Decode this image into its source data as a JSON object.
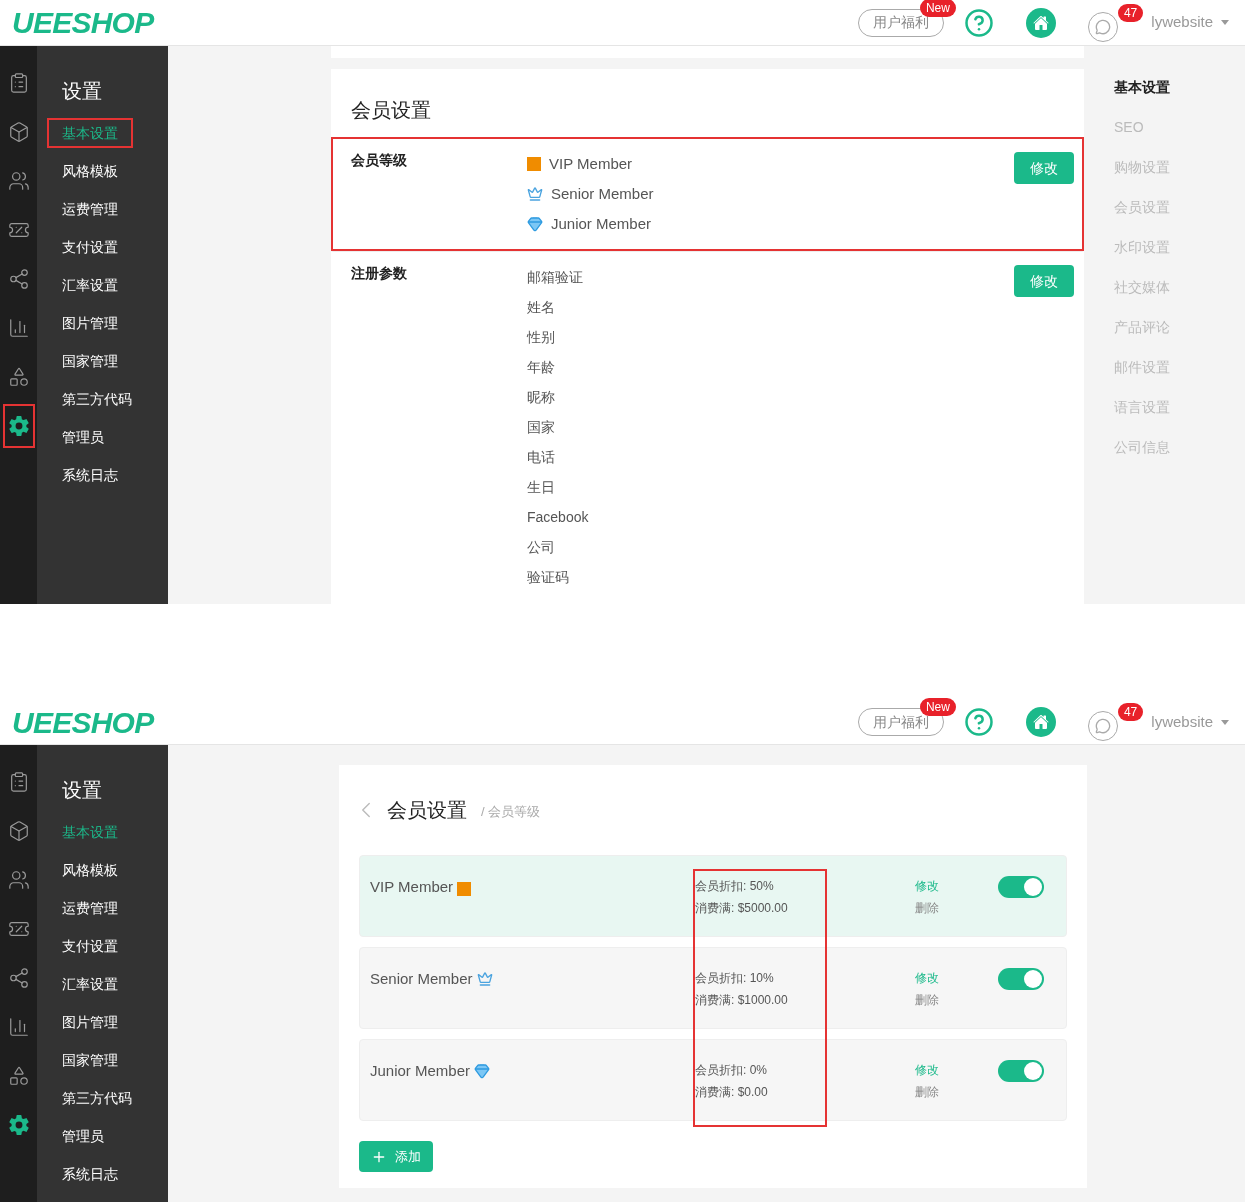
{
  "screens": [
    {
      "kind": "overview",
      "header": {
        "logo": "UEESHOP",
        "benefit": "用户福利",
        "benefit_badge": "New",
        "messages_count": "47",
        "user": "lywebsite"
      },
      "rail": [
        {
          "selected": false,
          "highlighted": false
        },
        {
          "selected": false,
          "highlighted": false
        },
        {
          "selected": false,
          "highlighted": false
        },
        {
          "selected": false,
          "highlighted": false
        },
        {
          "selected": false,
          "highlighted": false
        },
        {
          "selected": false,
          "highlighted": false
        },
        {
          "selected": false,
          "highlighted": false
        },
        {
          "selected": true,
          "highlighted": true
        }
      ],
      "menu": {
        "title": "设置",
        "items": [
          {
            "label": "基本设置",
            "selected": true,
            "highlighted": true
          },
          {
            "label": "风格模板",
            "selected": false,
            "highlighted": false
          },
          {
            "label": "运费管理",
            "selected": false,
            "highlighted": false
          },
          {
            "label": "支付设置",
            "selected": false,
            "highlighted": false
          },
          {
            "label": "汇率设置",
            "selected": false,
            "highlighted": false
          },
          {
            "label": "图片管理",
            "selected": false,
            "highlighted": false
          },
          {
            "label": "国家管理",
            "selected": false,
            "highlighted": false
          },
          {
            "label": "第三方代码",
            "selected": false,
            "highlighted": false
          },
          {
            "label": "管理员",
            "selected": false,
            "highlighted": false
          },
          {
            "label": "系统日志",
            "selected": false,
            "highlighted": false
          }
        ]
      },
      "title": "会员设置",
      "sections": [
        {
          "kind": "levels",
          "label": "会员等级",
          "highlighted": true,
          "button": "修改",
          "values": [
            "VIP Member",
            "Senior Member",
            "Junior Member"
          ]
        },
        {
          "kind": "fields",
          "label": "注册参数",
          "highlighted": false,
          "button": "修改",
          "values": [
            "邮箱验证",
            "姓名",
            "性别",
            "年龄",
            "昵称",
            "国家",
            "电话",
            "生日",
            "Facebook",
            "公司",
            "验证码"
          ]
        }
      ],
      "right_nav": [
        {
          "label": "基本设置",
          "selected": true
        },
        {
          "label": "SEO",
          "selected": false
        },
        {
          "label": "购物设置",
          "selected": false
        },
        {
          "label": "会员设置",
          "selected": false
        },
        {
          "label": "水印设置",
          "selected": false
        },
        {
          "label": "社交媒体",
          "selected": false
        },
        {
          "label": "产品评论",
          "selected": false
        },
        {
          "label": "邮件设置",
          "selected": false
        },
        {
          "label": "语言设置",
          "selected": false
        },
        {
          "label": "公司信息",
          "selected": false
        }
      ]
    },
    {
      "kind": "levels",
      "header": {
        "logo": "UEESHOP",
        "benefit": "用户福利",
        "benefit_badge": "New",
        "messages_count": "47",
        "user": "lywebsite"
      },
      "rail": [
        {
          "selected": false,
          "highlighted": false
        },
        {
          "selected": false,
          "highlighted": false
        },
        {
          "selected": false,
          "highlighted": false
        },
        {
          "selected": false,
          "highlighted": false
        },
        {
          "selected": false,
          "highlighted": false
        },
        {
          "selected": false,
          "highlighted": false
        },
        {
          "selected": false,
          "highlighted": false
        },
        {
          "selected": true,
          "highlighted": false
        }
      ],
      "menu": {
        "title": "设置",
        "items": [
          {
            "label": "基本设置",
            "selected": true,
            "highlighted": false
          },
          {
            "label": "风格模板",
            "selected": false,
            "highlighted": false
          },
          {
            "label": "运费管理",
            "selected": false,
            "highlighted": false
          },
          {
            "label": "支付设置",
            "selected": false,
            "highlighted": false
          },
          {
            "label": "汇率设置",
            "selected": false,
            "highlighted": false
          },
          {
            "label": "图片管理",
            "selected": false,
            "highlighted": false
          },
          {
            "label": "国家管理",
            "selected": false,
            "highlighted": false
          },
          {
            "label": "第三方代码",
            "selected": false,
            "highlighted": false
          },
          {
            "label": "管理员",
            "selected": false,
            "highlighted": false
          },
          {
            "label": "系统日志",
            "selected": false,
            "highlighted": false
          }
        ]
      },
      "title": "会员设置",
      "crumb": "/ 会员等级",
      "column_highlighted": true,
      "add": "添加",
      "levels": [
        {
          "name": "VIP Member",
          "selected": true,
          "discount": "会员折扣: 50%",
          "threshold": "消费满: $5000.00",
          "edit": "修改",
          "delete": "删除",
          "on": true
        },
        {
          "name": "Senior Member",
          "selected": false,
          "discount": "会员折扣: 10%",
          "threshold": "消费满: $1000.00",
          "edit": "修改",
          "delete": "删除",
          "on": true
        },
        {
          "name": "Junior Member",
          "selected": false,
          "discount": "会员折扣: 0%",
          "threshold": "消费满: $0.00",
          "edit": "修改",
          "delete": "删除",
          "on": true
        }
      ]
    }
  ]
}
